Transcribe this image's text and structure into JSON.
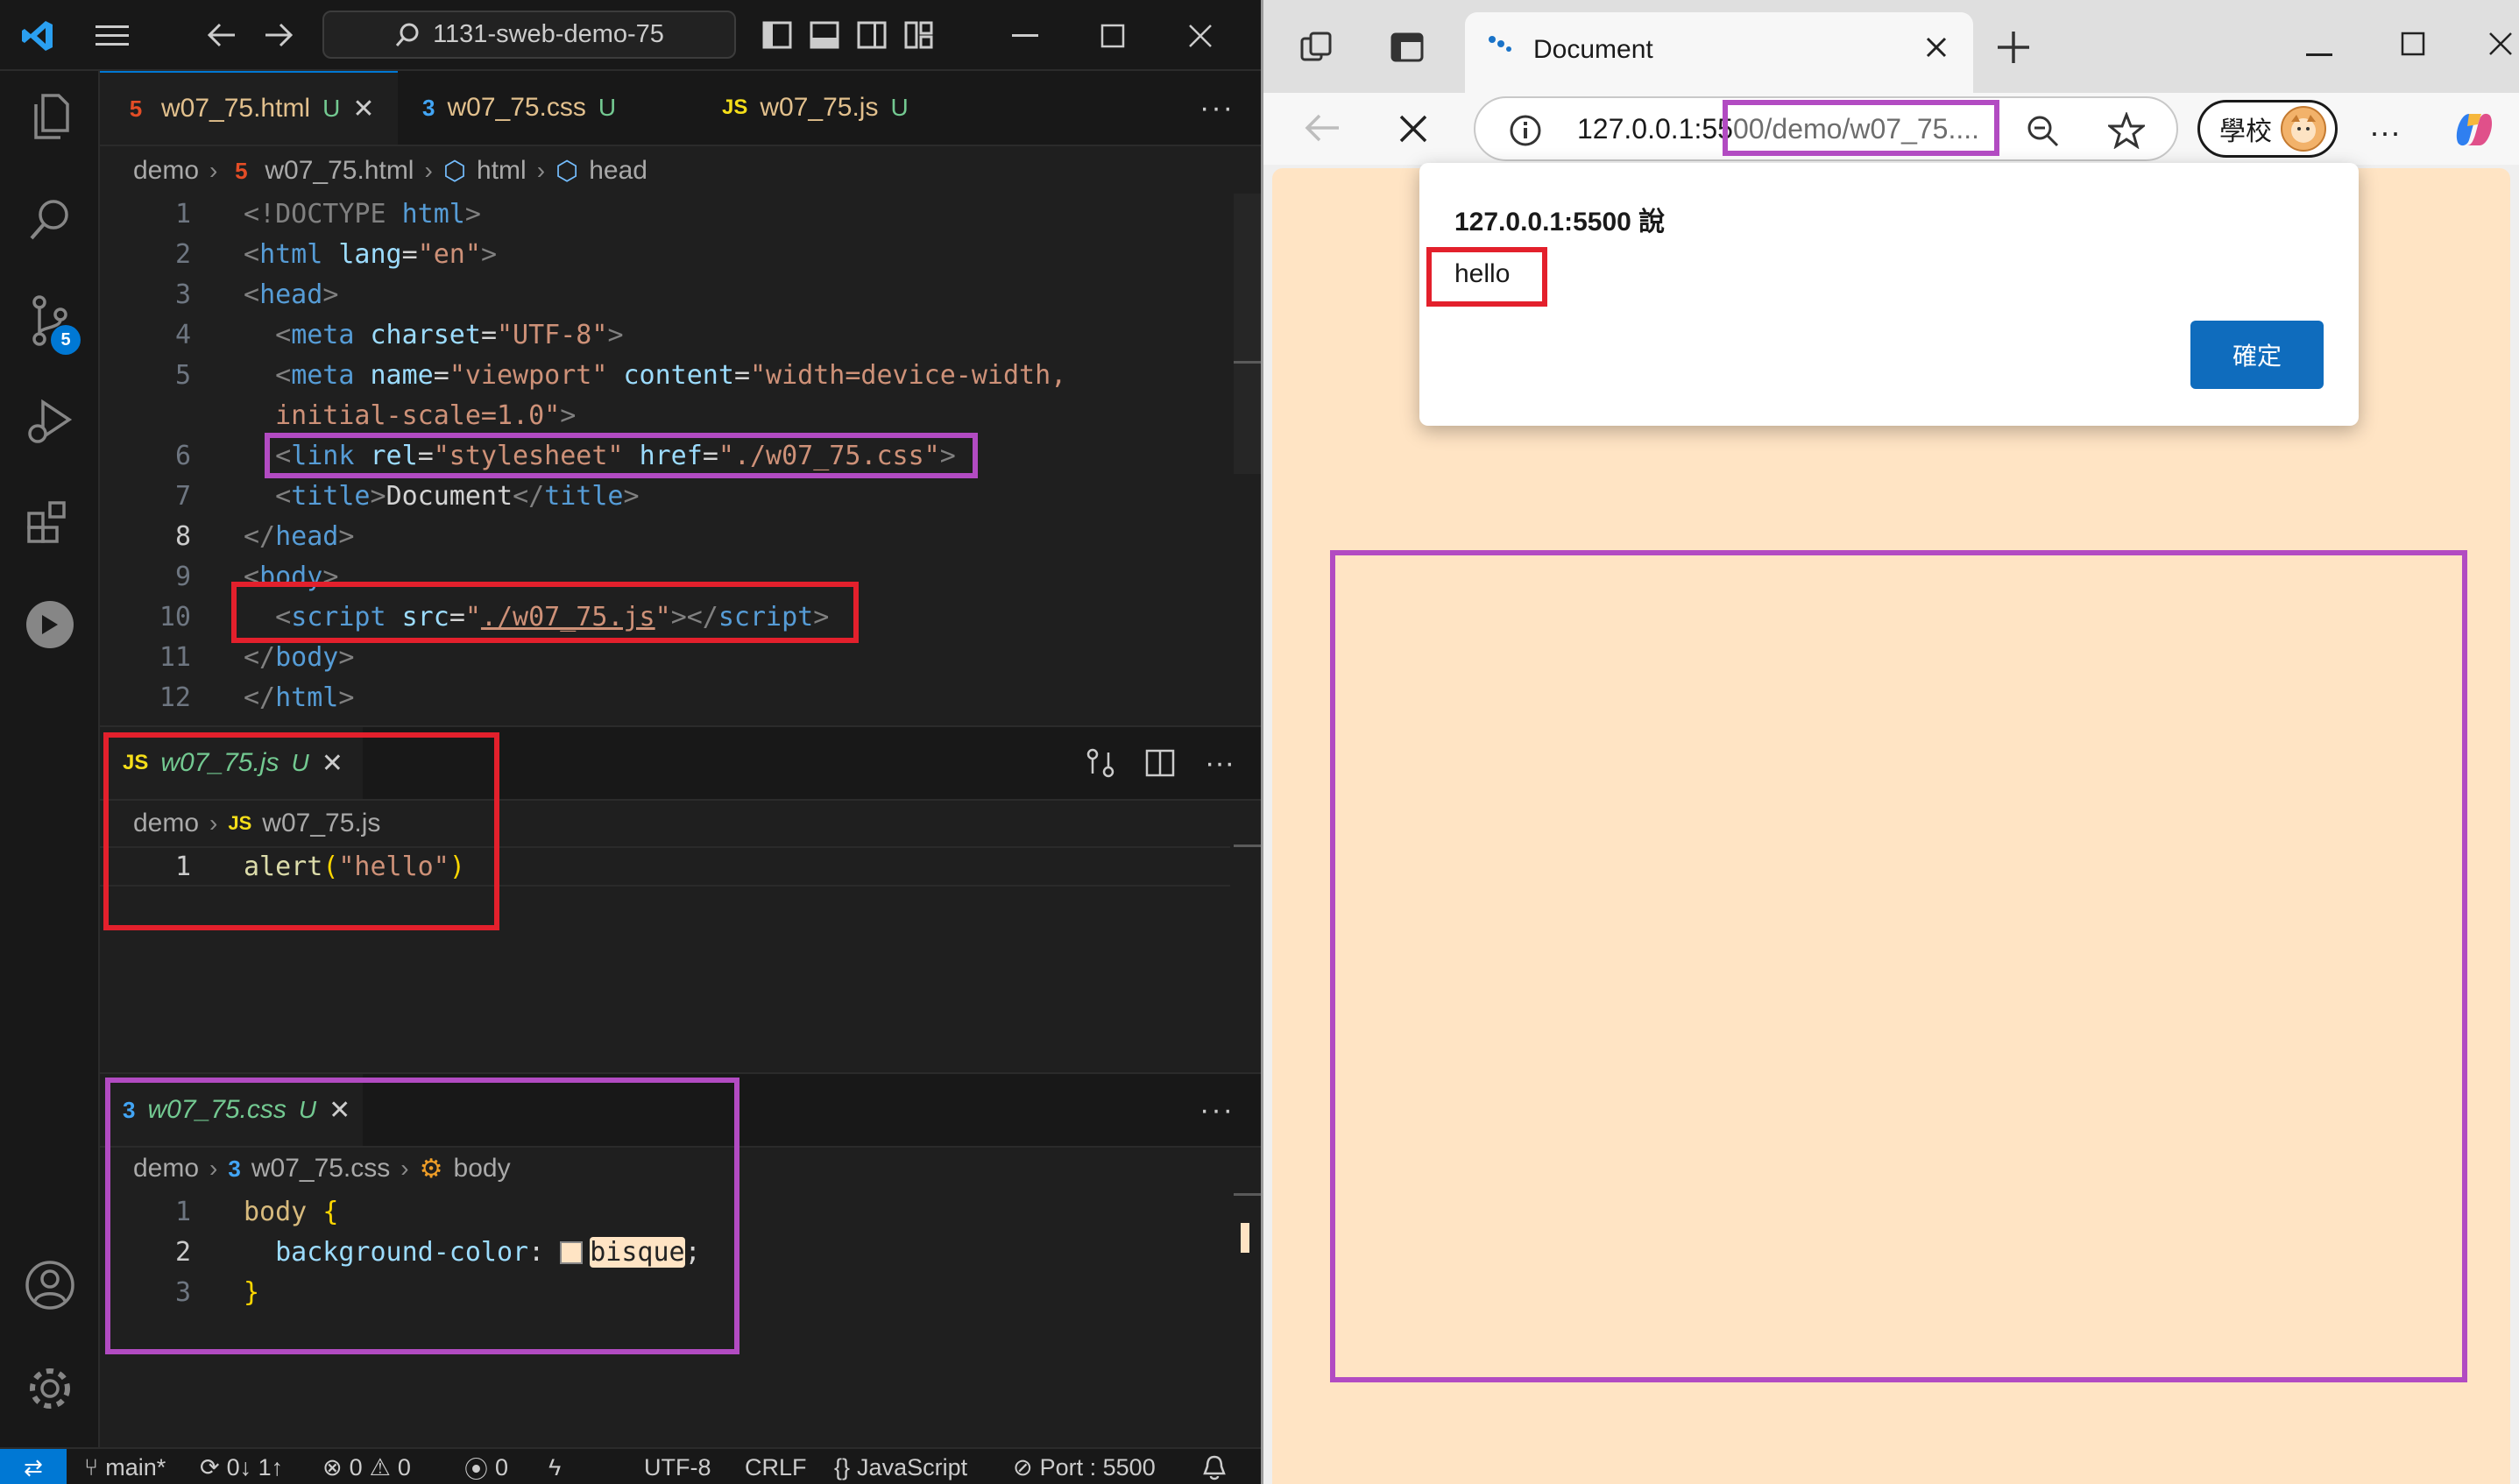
{
  "vscode": {
    "search_text": "1131-sweb-demo-75",
    "tabs": [
      {
        "label": "w07_75.html",
        "status": "U"
      },
      {
        "label": "w07_75.css",
        "status": "U"
      },
      {
        "label": "w07_75.js",
        "status": "U"
      }
    ],
    "html_breadcrumb": {
      "folder": "demo",
      "file": "w07_75.html",
      "node1": "html",
      "node2": "head"
    },
    "html_code": [
      {
        "n": "1"
      },
      {
        "n": "2"
      },
      {
        "n": "3"
      },
      {
        "n": "4"
      },
      {
        "n": "5"
      },
      {
        "n": "6"
      },
      {
        "n": "7"
      },
      {
        "n": "8"
      },
      {
        "n": "9"
      },
      {
        "n": "10"
      },
      {
        "n": "11"
      },
      {
        "n": "12"
      }
    ],
    "js_panel": {
      "tab": {
        "label": "w07_75.js",
        "status": "U"
      },
      "breadcrumb": {
        "folder": "demo",
        "file": "w07_75.js"
      },
      "line_number": "1"
    },
    "css_panel": {
      "tab": {
        "label": "w07_75.css",
        "status": "U"
      },
      "breadcrumb": {
        "folder": "demo",
        "file": "w07_75.css",
        "node": "body"
      },
      "line_numbers": [
        "1",
        "2",
        "3"
      ]
    },
    "statusbar": {
      "branch": "main*",
      "sync": "0↓ 1↑",
      "errors": "0",
      "warnings": "0",
      "ports": "0",
      "encoding": "UTF-8",
      "eol": "CRLF",
      "language": "JavaScript",
      "port": "Port : 5500"
    },
    "colors": {
      "accent": "#0078d4",
      "editor_bg": "#1f1f1f",
      "highlight_red": "#e3202c",
      "highlight_purple": "#b24bc2"
    }
  },
  "browser": {
    "tab_title": "Document",
    "address": {
      "host": "127.0.0.1:55",
      "path": "00/demo/w07_75...."
    },
    "profile_label": "學校",
    "dialog": {
      "title": "127.0.0.1:5500 說",
      "message": "hello",
      "ok_label": "確定"
    },
    "page_bg": "#ffe4c4"
  }
}
